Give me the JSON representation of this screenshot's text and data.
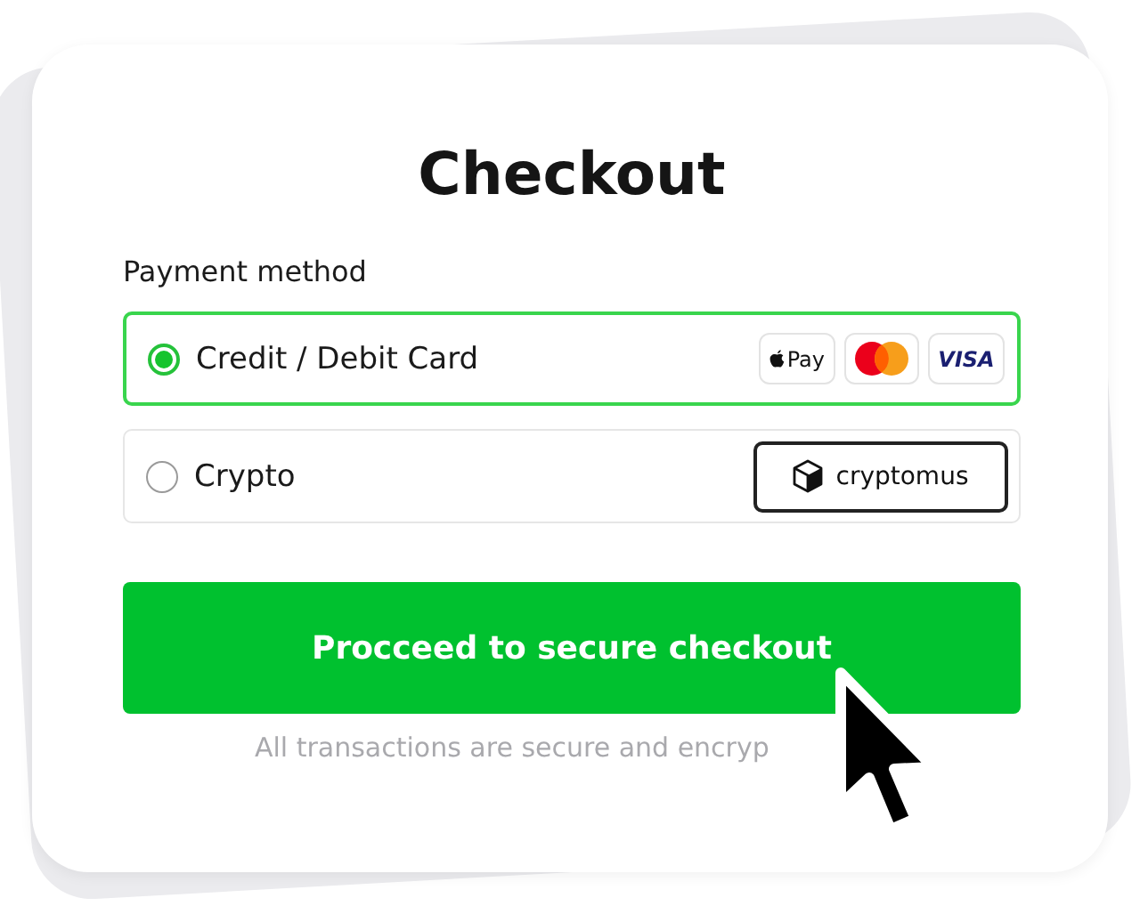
{
  "title": "Checkout",
  "section_label": "Payment method",
  "methods": [
    {
      "label": "Credit / Debit Card",
      "selected": true,
      "badges": [
        {
          "kind": "applepay",
          "text": "Pay"
        },
        {
          "kind": "mastercard"
        },
        {
          "kind": "visa",
          "text": "VISA"
        }
      ]
    },
    {
      "label": "Crypto",
      "selected": false,
      "badges": [
        {
          "kind": "cryptomus",
          "text": "cryptomus"
        }
      ]
    }
  ],
  "button": "Procceed to secure checkout",
  "note": "All transactions are secure and encryp"
}
